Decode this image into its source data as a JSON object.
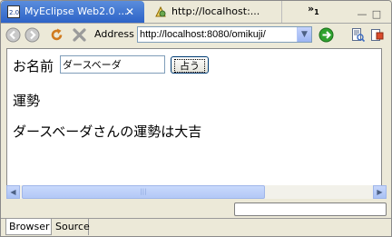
{
  "tabs": [
    {
      "label": "MyEclipse Web2.0 ...",
      "close": "✕",
      "icon": "myeclipse-icon"
    },
    {
      "label": "http://localhost:...",
      "icon": "web-page-icon"
    }
  ],
  "overflow": {
    "label": "»",
    "count": "1"
  },
  "window_controls": {
    "minimize": "—",
    "maximize": "□"
  },
  "toolbar": {
    "address_label": "Address",
    "address_value": "http://localhost:8080/omikuji/",
    "dropdown_glyph": "▼"
  },
  "form": {
    "name_label": "お名前",
    "name_value": "ダースベーダ",
    "submit_label": "占う"
  },
  "page": {
    "heading": "運勢",
    "result": "ダースベーダさんの運勢は大吉"
  },
  "scrollbar": {
    "left": "◀",
    "right": "▶",
    "grip": "|||"
  },
  "status": {
    "text": ""
  },
  "bottom_tabs": [
    {
      "label": "Browser"
    },
    {
      "label": "Source"
    }
  ],
  "colors": {
    "active_tab": "#2d63c7",
    "chrome": "#ece9d8",
    "scroll": "#b3c8f6"
  }
}
